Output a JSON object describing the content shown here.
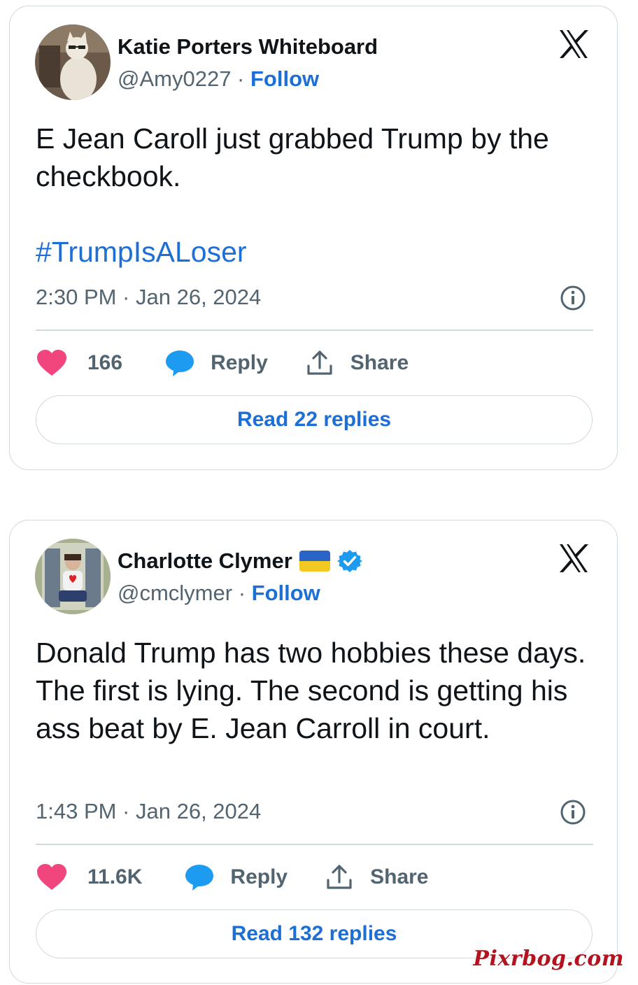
{
  "tweets": [
    {
      "author_name": "Katie Porters Whiteboard",
      "handle": "@Amy0227",
      "separator": " · ",
      "follow_label": "Follow",
      "text_line": "E Jean Caroll just grabbed Trump by the checkbook.",
      "hashtag": "#TrumpIsALoser",
      "timestamp": "2:30 PM · Jan 26, 2024",
      "like_count": "166",
      "reply_label": "Reply",
      "share_label": "Share",
      "read_replies_label": "Read 22 replies",
      "verified": false,
      "flag": false
    },
    {
      "author_name": "Charlotte Clymer",
      "handle": "@cmclymer",
      "separator": " · ",
      "follow_label": "Follow",
      "text_line": "Donald Trump has two hobbies these days. The first is lying. The second is getting his ass beat by E. Jean Carroll in court.",
      "timestamp": "1:43 PM · Jan 26, 2024",
      "like_count": "11.6K",
      "reply_label": "Reply",
      "share_label": "Share",
      "read_replies_label": "Read 132 replies",
      "verified": true,
      "flag": true
    }
  ],
  "watermark": "Pixrbog.com",
  "colors": {
    "accent_blue": "#1d6fd6",
    "heart_pink": "#f91880",
    "reply_blue": "#1d9bf0",
    "muted_gray": "#536471",
    "border": "#cfd9de"
  },
  "icons": [
    "x-logo-icon",
    "info-icon",
    "heart-icon",
    "reply-bubble-icon",
    "share-icon",
    "verified-badge-icon",
    "ukraine-flag-icon"
  ]
}
